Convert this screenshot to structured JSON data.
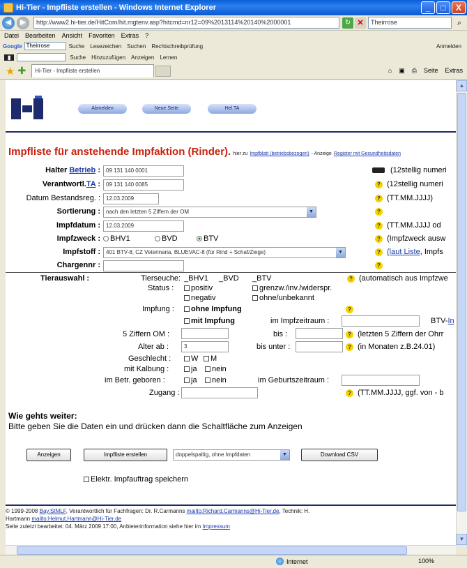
{
  "window": {
    "title": "Hi-Tier - Impfliste erstellen - Windows Internet Explorer",
    "minimize": "_",
    "maximize": "□",
    "close": "X"
  },
  "address": {
    "url": "http://www2.hi-tier.de/HitCom/hit.mgtenv.asp?hitcmd=nr12=09%2013114%20140%2000001",
    "search_value": "Theirrose"
  },
  "menu": [
    "Datei",
    "Bearbeiten",
    "Ansicht",
    "Favoriten",
    "Extras",
    "?"
  ],
  "google_toolbar": {
    "label": "Google",
    "query": "Theirrose",
    "items": [
      "Suche",
      "Lesezeichen",
      "Suchen",
      "Rechtschreibprüfung",
      "Anmelden"
    ],
    "items2": [
      "Suche",
      "Hinzuzufügen",
      "Anzeigen",
      "Lernen"
    ]
  },
  "tabbar": {
    "tab_label": "Hi-Tier - Impfliste erstellen",
    "commands": [
      "Seite",
      "Extras"
    ]
  },
  "nav": {
    "buttons": [
      "Abmelden",
      "Neue Seite",
      "Hel.TA"
    ]
  },
  "heading": {
    "title": "Impfliste für anstehende Impfaktion (Rinder).",
    "sub_prefix": "hier zu",
    "link1": "Impfblatt (betriebsbezogen)",
    "sub_mid": "- Anzeige",
    "link2": "Register mit Gesundheitsdaten"
  },
  "form": {
    "halter_label": "Halter",
    "halter_link": "Betrieb",
    "halter_value": "09 131 140 0001",
    "halter_hint": "(12stellig numeri",
    "verantw_label": "Verantwortl.",
    "verantw_link": "TA",
    "verantw_value": "09 131 140 0085",
    "verantw_hint": "(12stellig numeri",
    "datum_label": "Datum Bestandsreg. :",
    "datum_value": "12.03.2009",
    "datum_hint": "(TT.MM.JJJJ)",
    "sort_label": "Sortierung :",
    "sort_value": "nach den letzten 5 Ziffern der OM",
    "impfdatum_label": "Impfdatum :",
    "impfdatum_value": "12.03.2009",
    "impfdatum_hint": "(TT.MM.JJJJ od",
    "impfzweck_label": "Impfzweck :",
    "impfzweck_options": [
      "BHV1",
      "BVD",
      "BTV"
    ],
    "impfzweck_hint": "(Impfzweck ausw",
    "impfstoff_label": "Impfstoff :",
    "impfstoff_value": "401 BTV-8, CZ Veterinaria, BLUEVAC-8 (für Rind + Schaf/Ziege)",
    "impfstoff_hint_link": "(laut Liste",
    "impfstoff_hint_rest": ", Impfs",
    "charge_label": "Chargennr :"
  },
  "tierauswahl": {
    "label": "Tierauswahl :",
    "tierseuche_label": "Tierseuche:",
    "tierseuche_opts": [
      "_BHV1",
      "_BVD",
      "_BTV"
    ],
    "tierseuche_hint": "(automatisch aus Impfzwe",
    "status_label": "Status :",
    "status_opts": [
      "positiv",
      "negativ",
      "grenzw./inv./widerspr.",
      "ohne/unbekannt"
    ],
    "impfung_label": "Impfung :",
    "impfung_opts": [
      "ohne Impfung",
      "mit Impfung"
    ],
    "impfzeitraum_label": "im Impfzeitraum :",
    "btv_label": "BTV-",
    "btv_link": "In",
    "ziffern_label": "5 Ziffern OM :",
    "bis_label": "bis :",
    "ziffern_hint": "(letzten 5 Ziffern der Ohrr",
    "alter_label": "Alter ab :",
    "alter_value": "3",
    "bis_unter_label": "bis unter :",
    "alter_hint": "(in Monaten z.B.24.01)",
    "geschlecht_label": "Geschlecht :",
    "geschlecht_opts": [
      "W",
      "M"
    ],
    "kalbung_label": "mit Kalbung :",
    "ja_nein": [
      "ja",
      "nein"
    ],
    "geboren_label": "im Betr. geboren :",
    "geburtszeitraum_label": "im Geburtszeitraum :",
    "zugang_label": "Zugang :",
    "zugang_hint": "(TT.MM.JJJJ, ggf. von - b"
  },
  "weiter": {
    "heading": "Wie gehts weiter:",
    "text": "Bitte geben Sie die Daten ein und drücken dann die Schaltfläche zum Anzeigen"
  },
  "actions": {
    "anzeigen": "Anzeigen",
    "impfliste": "Impfliste erstellen",
    "format": "doppelspaltig, ohne Impfdaten",
    "download": "Download CSV",
    "elektr": "Elektr. Impfauftrag speichern"
  },
  "footer": {
    "line1_prefix": "© 1999-2008",
    "line1_link1": "Bay.StMLF",
    "line1_mid": ", Verantwortlich für Fachfragen: Dr. R.Carmanns",
    "line1_link2": "mailto:Richard.Carmanns@Hi-Tier.de",
    "line1_tail": ", Technik: H.",
    "line2_prefix": "Hartmann",
    "line2_link": "mailto:Helmut.Hartmann@Hi-Tier.de",
    "line3": "Seite zuletzt bearbeitet: 04. März 2009 17:00, Anbieterinformation siehe hier im",
    "line3_link": "Impressum"
  },
  "status": {
    "zone": "Internet",
    "zoom": "100%"
  }
}
